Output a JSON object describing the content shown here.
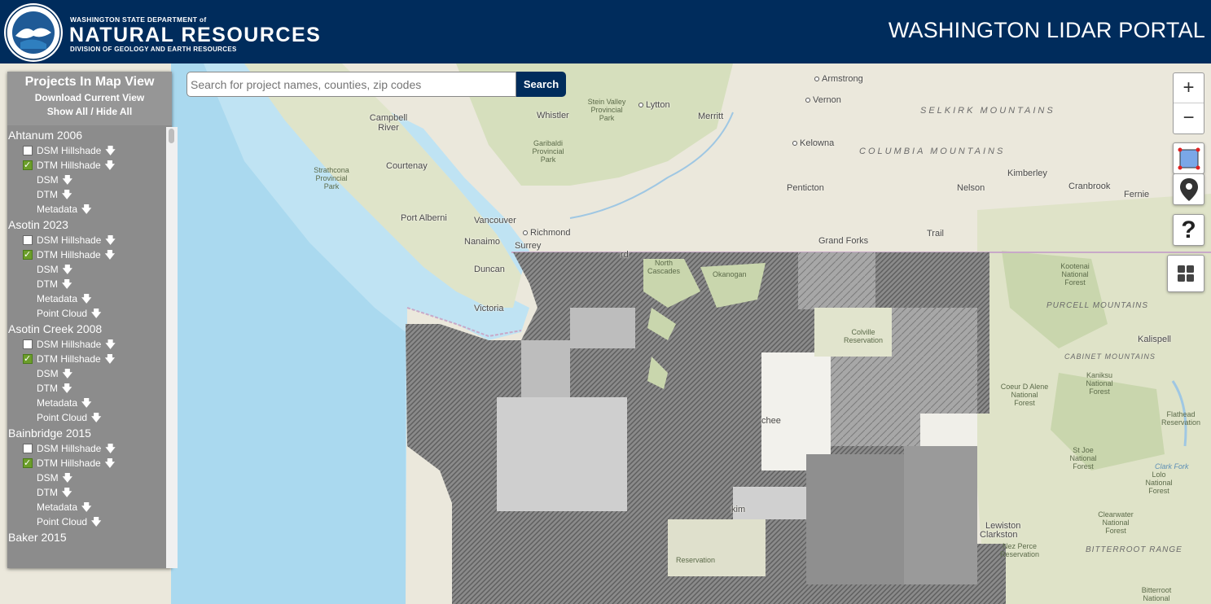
{
  "header": {
    "org_small": "WASHINGTON STATE DEPARTMENT of",
    "org_big": "NATURAL RESOURCES",
    "org_division": "DIVISION OF GEOLOGY AND EARTH RESOURCES",
    "portal_title": "WASHINGTON LIDAR PORTAL",
    "colors": {
      "header_bg": "#002c5c",
      "text": "#ffffff"
    }
  },
  "panel": {
    "title": "Projects In Map View",
    "download_link": "Download Current View",
    "show_all": "Show All",
    "separator": " / ",
    "hide_all": "Hide All",
    "projects": [
      {
        "name": "Ahtanum 2006",
        "layers": [
          {
            "label": "DSM Hillshade",
            "checkbox": true,
            "checked": false
          },
          {
            "label": "DTM Hillshade",
            "checkbox": true,
            "checked": true
          },
          {
            "label": "DSM",
            "checkbox": false
          },
          {
            "label": "DTM",
            "checkbox": false
          },
          {
            "label": "Metadata",
            "checkbox": false
          }
        ]
      },
      {
        "name": "Asotin 2023",
        "layers": [
          {
            "label": "DSM Hillshade",
            "checkbox": true,
            "checked": false
          },
          {
            "label": "DTM Hillshade",
            "checkbox": true,
            "checked": true
          },
          {
            "label": "DSM",
            "checkbox": false
          },
          {
            "label": "DTM",
            "checkbox": false
          },
          {
            "label": "Metadata",
            "checkbox": false
          },
          {
            "label": "Point Cloud",
            "checkbox": false
          }
        ]
      },
      {
        "name": "Asotin Creek 2008",
        "layers": [
          {
            "label": "DSM Hillshade",
            "checkbox": true,
            "checked": false
          },
          {
            "label": "DTM Hillshade",
            "checkbox": true,
            "checked": true
          },
          {
            "label": "DSM",
            "checkbox": false
          },
          {
            "label": "DTM",
            "checkbox": false
          },
          {
            "label": "Metadata",
            "checkbox": false
          },
          {
            "label": "Point Cloud",
            "checkbox": false
          }
        ]
      },
      {
        "name": "Bainbridge 2015",
        "layers": [
          {
            "label": "DSM Hillshade",
            "checkbox": true,
            "checked": false
          },
          {
            "label": "DTM Hillshade",
            "checkbox": true,
            "checked": true
          },
          {
            "label": "DSM",
            "checkbox": false
          },
          {
            "label": "DTM",
            "checkbox": false
          },
          {
            "label": "Metadata",
            "checkbox": false
          },
          {
            "label": "Point Cloud",
            "checkbox": false
          }
        ]
      },
      {
        "name": "Baker 2015",
        "layers": []
      }
    ]
  },
  "search": {
    "placeholder": "Search for project names, counties, zip codes",
    "value": "",
    "button_label": "Search"
  },
  "controls": {
    "zoom_in": "+",
    "zoom_out": "−",
    "draw_icon": "draw-rectangle-icon",
    "location_icon": "map-pin-icon",
    "help_label": "?",
    "basemap_icon": "basemap-grid-icon"
  },
  "map_labels": {
    "places": [
      "Armstrong",
      "Vernon",
      "Lytton",
      "Merritt",
      "Whistler",
      "Campbell River",
      "Kelowna",
      "Courtenay",
      "Penticton",
      "Nelson",
      "Kimberley",
      "Cranbrook",
      "Fernie",
      "Port Alberni",
      "Vancouver",
      "Richmond",
      "Nanaimo",
      "Surrey",
      "Grand Forks",
      "Trail",
      "Duncan",
      "Victoria",
      "Kalispell",
      "Lewiston",
      "Clarkston"
    ],
    "parks": [
      "Stein Valley Provincial Park",
      "Garibaldi Provincial Park",
      "Strathcona Provincial Park",
      "North Cascades",
      "Okanogan",
      "Colville Reservation",
      "Kootenai National Forest",
      "Kaniksu National Forest",
      "Coeur D Alene National Forest",
      "Flathead Reservation",
      "St Joe National Forest",
      "Lolo National Forest",
      "Clearwater National Forest",
      "Nez Perce Reservation",
      "Bitterroot National",
      "Reservation"
    ],
    "regions": [
      "SELKIRK MOUNTAINS",
      "COLUMBIA MOUNTAINS",
      "PURCELL MOUNTAINS",
      "CABINET MOUNTAINS",
      "BITTERROOT RANGE"
    ],
    "partial": [
      "rd",
      "chee",
      "kim",
      "Clark Fork"
    ]
  }
}
